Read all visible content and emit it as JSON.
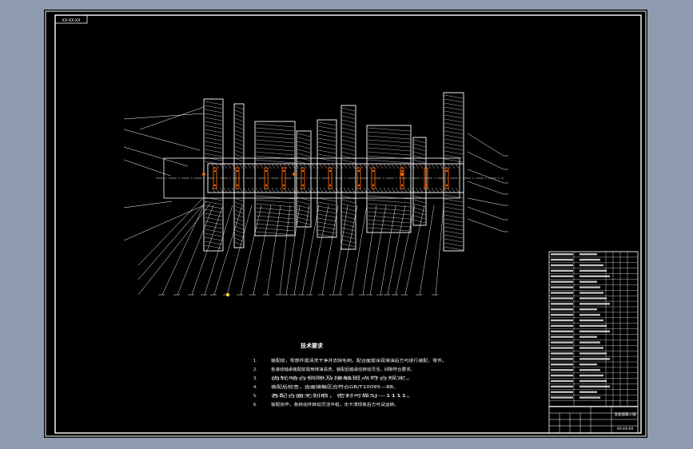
{
  "drawing": {
    "code_box": "XX-XX-XX",
    "technical_requirements": {
      "title": "技术要求",
      "items": [
        {
          "num": "1.",
          "text": "装配前，零部件需清洗干净并去除毛刺，配合面需涂润滑油后方可进行装配，零件。"
        },
        {
          "num": "2.",
          "text": "各滚动轴承装配前需用煤油清洗，装配后轴承应转动灵活，间隙符合要求。"
        },
        {
          "num": "3.",
          "text": "齿轮啮合侧隙及接触斑点符合规定。"
        },
        {
          "num": "4.",
          "text": "装配后检查，齿面接触区应符合GB/T10095—88。"
        },
        {
          "num": "5.",
          "text": "各配合面无划痕，密封可靠SJ—1111。"
        },
        {
          "num": "6.",
          "text": "装配完毕，各转动件转动灵活平稳，无卡滞现象后方可试运转。"
        }
      ]
    },
    "title_block": {
      "name": "变速器输入轴",
      "code": "XX-XX-XX"
    },
    "colors": {
      "line": "#ffffff",
      "bearing": "#ff6600",
      "leader": "#ffffff",
      "background": "#000000"
    }
  }
}
